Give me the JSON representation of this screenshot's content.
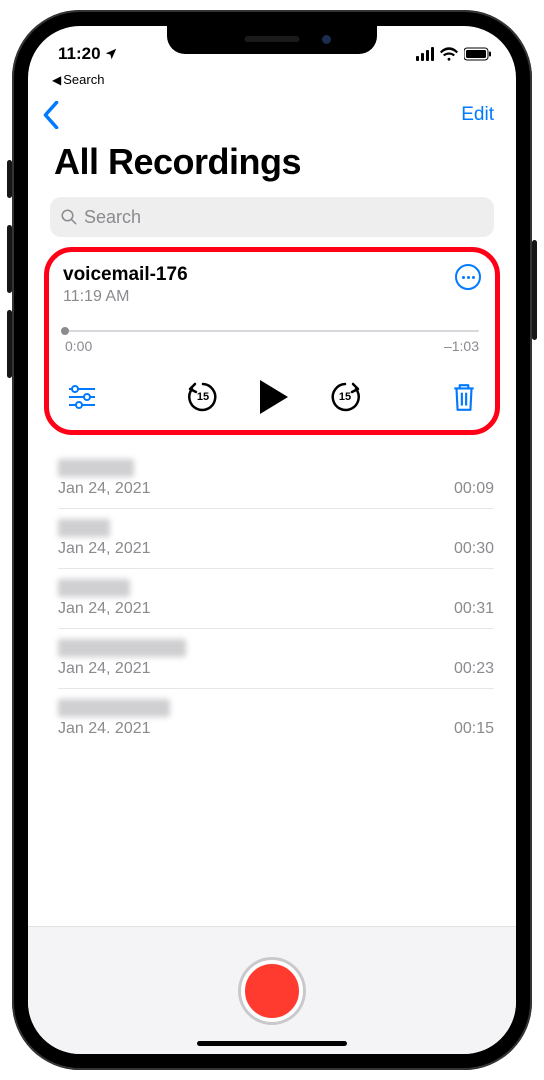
{
  "status": {
    "time": "11:20",
    "back_breadcrumb": "Search"
  },
  "nav": {
    "edit": "Edit"
  },
  "title": "All Recordings",
  "search": {
    "placeholder": "Search"
  },
  "selected": {
    "title": "voicemail-176",
    "subtitle": "11:19 AM",
    "elapsed": "0:00",
    "remaining": "–1:03",
    "skip_amount": "15"
  },
  "rows": [
    {
      "date": "Jan 24, 2021",
      "duration": "00:09",
      "blur_w": 76
    },
    {
      "date": "Jan 24, 2021",
      "duration": "00:30",
      "blur_w": 52
    },
    {
      "date": "Jan 24, 2021",
      "duration": "00:31",
      "blur_w": 72
    },
    {
      "date": "Jan 24, 2021",
      "duration": "00:23",
      "blur_w": 128
    },
    {
      "date": "Jan 24. 2021",
      "duration": "00:15",
      "blur_w": 112
    }
  ],
  "colors": {
    "accent": "#007aff",
    "highlight": "#ff0016",
    "record": "#ff3b30"
  }
}
